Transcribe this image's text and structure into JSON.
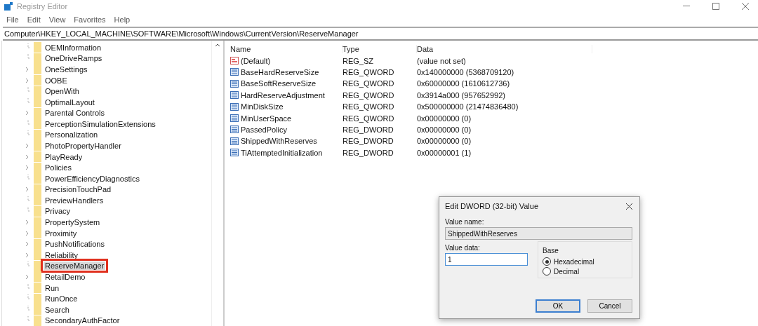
{
  "window": {
    "title": "Registry Editor"
  },
  "menu": [
    "File",
    "Edit",
    "View",
    "Favorites",
    "Help"
  ],
  "address": "Computer\\HKEY_LOCAL_MACHINE\\SOFTWARE\\Microsoft\\Windows\\CurrentVersion\\ReserveManager",
  "tree": [
    {
      "label": "OEMInformation",
      "kind": "leaf",
      "selected": false,
      "marked": false
    },
    {
      "label": "OneDriveRamps",
      "kind": "leaf",
      "selected": false,
      "marked": false
    },
    {
      "label": "OneSettings",
      "kind": "expandable",
      "selected": false,
      "marked": false
    },
    {
      "label": "OOBE",
      "kind": "expandable",
      "selected": false,
      "marked": false
    },
    {
      "label": "OpenWith",
      "kind": "leaf",
      "selected": false,
      "marked": false
    },
    {
      "label": "OptimalLayout",
      "kind": "leaf",
      "selected": false,
      "marked": false
    },
    {
      "label": "Parental Controls",
      "kind": "expandable",
      "selected": false,
      "marked": false
    },
    {
      "label": "PerceptionSimulationExtensions",
      "kind": "leaf",
      "selected": false,
      "marked": false
    },
    {
      "label": "Personalization",
      "kind": "leaf",
      "selected": false,
      "marked": false
    },
    {
      "label": "PhotoPropertyHandler",
      "kind": "expandable",
      "selected": false,
      "marked": false
    },
    {
      "label": "PlayReady",
      "kind": "expandable",
      "selected": false,
      "marked": false
    },
    {
      "label": "Policies",
      "kind": "expandable",
      "selected": false,
      "marked": false
    },
    {
      "label": "PowerEfficiencyDiagnostics",
      "kind": "leaf",
      "selected": false,
      "marked": false
    },
    {
      "label": "PrecisionTouchPad",
      "kind": "expandable",
      "selected": false,
      "marked": false
    },
    {
      "label": "PreviewHandlers",
      "kind": "leaf",
      "selected": false,
      "marked": false
    },
    {
      "label": "Privacy",
      "kind": "leaf",
      "selected": false,
      "marked": false
    },
    {
      "label": "PropertySystem",
      "kind": "expandable",
      "selected": false,
      "marked": false
    },
    {
      "label": "Proximity",
      "kind": "expandable",
      "selected": false,
      "marked": false
    },
    {
      "label": "PushNotifications",
      "kind": "expandable",
      "selected": false,
      "marked": false
    },
    {
      "label": "Reliability",
      "kind": "expandable",
      "selected": false,
      "marked": false
    },
    {
      "label": "ReserveManager",
      "kind": "leaf",
      "selected": true,
      "marked": true
    },
    {
      "label": "RetailDemo",
      "kind": "expandable",
      "selected": false,
      "marked": false
    },
    {
      "label": "Run",
      "kind": "leaf",
      "selected": false,
      "marked": false
    },
    {
      "label": "RunOnce",
      "kind": "leaf",
      "selected": false,
      "marked": false
    },
    {
      "label": "Search",
      "kind": "leaf",
      "selected": false,
      "marked": false
    },
    {
      "label": "SecondaryAuthFactor",
      "kind": "leaf",
      "selected": false,
      "marked": false
    }
  ],
  "table": {
    "columns": [
      "Name",
      "Type",
      "Data"
    ],
    "rows": [
      {
        "kind": "string",
        "name": "(Default)",
        "type": "REG_SZ",
        "data": "(value not set)"
      },
      {
        "kind": "binary",
        "name": "BaseHardReserveSize",
        "type": "REG_QWORD",
        "data": "0x140000000 (5368709120)"
      },
      {
        "kind": "binary",
        "name": "BaseSoftReserveSize",
        "type": "REG_QWORD",
        "data": "0x60000000 (1610612736)"
      },
      {
        "kind": "binary",
        "name": "HardReserveAdjustment",
        "type": "REG_QWORD",
        "data": "0x3914a000 (957652992)"
      },
      {
        "kind": "binary",
        "name": "MinDiskSize",
        "type": "REG_QWORD",
        "data": "0x500000000 (21474836480)"
      },
      {
        "kind": "binary",
        "name": "MinUserSpace",
        "type": "REG_QWORD",
        "data": "0x00000000 (0)"
      },
      {
        "kind": "binary",
        "name": "PassedPolicy",
        "type": "REG_DWORD",
        "data": "0x00000000 (0)"
      },
      {
        "kind": "binary",
        "name": "ShippedWithReserves",
        "type": "REG_DWORD",
        "data": "0x00000000 (0)"
      },
      {
        "kind": "binary",
        "name": "TiAttemptedInitialization",
        "type": "REG_DWORD",
        "data": "0x00000001 (1)"
      }
    ]
  },
  "dialog": {
    "title": "Edit DWORD (32-bit) Value",
    "value_name_label": "Value name:",
    "value_name": "ShippedWithReserves",
    "value_data_label": "Value data:",
    "value_data": "1",
    "base_label": "Base",
    "radios": [
      {
        "label": "Hexadecimal",
        "selected": true
      },
      {
        "label": "Decimal",
        "selected": false
      }
    ],
    "buttons": [
      {
        "label": "OK",
        "default": true
      },
      {
        "label": "Cancel",
        "default": false
      }
    ]
  }
}
